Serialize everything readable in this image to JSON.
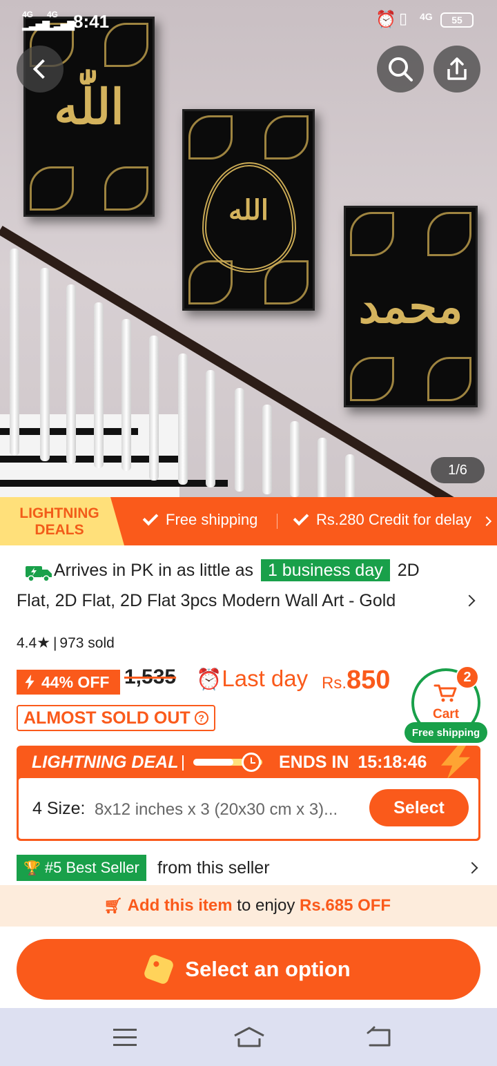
{
  "status_bar": {
    "time": "8:41",
    "network": "4G",
    "battery": "55"
  },
  "gallery": {
    "counter": "1/6"
  },
  "deal_banner": {
    "badge_line1": "LIGHTNING",
    "badge_line2": "DEALS",
    "benefit_1": "Free shipping",
    "benefit_2": "Rs.280 Credit for delay"
  },
  "product": {
    "arrives_prefix": "Arrives in PK in as little as",
    "arrives_days": "1 business day",
    "title_start": "2D",
    "title_line2": "Flat, 2D Flat, 2D Flat 3pcs Modern Wall Art - Gold",
    "rating": "4.4",
    "sold": "973 sold",
    "discount": "44% OFF",
    "original_price": "1,535",
    "last_day": "Last day",
    "currency": "Rs.",
    "price": "850",
    "stock_warning": "ALMOST SOLD OUT"
  },
  "cart": {
    "label": "Cart",
    "count": "2",
    "free_shipping": "Free shipping"
  },
  "lightning_deal": {
    "title": "LIGHTNING DEAL",
    "ends_label": "ENDS IN",
    "countdown": "15:18:46",
    "progress": 0.58,
    "size_label": "4 Size:",
    "size_value": "8x12 inches x 3 (20x30 cm x 3)...",
    "select_label": "Select"
  },
  "best_seller": {
    "badge": "#5 Best Seller",
    "text": "from this seller"
  },
  "add_bar": {
    "link": "Add this item",
    "middle": "to enjoy",
    "amount": "Rs.685 OFF"
  },
  "cta": {
    "label": "Select an option"
  },
  "colors": {
    "accent": "#fa5a1b",
    "green": "#19a04a",
    "badge_yellow": "#ffe07a"
  }
}
